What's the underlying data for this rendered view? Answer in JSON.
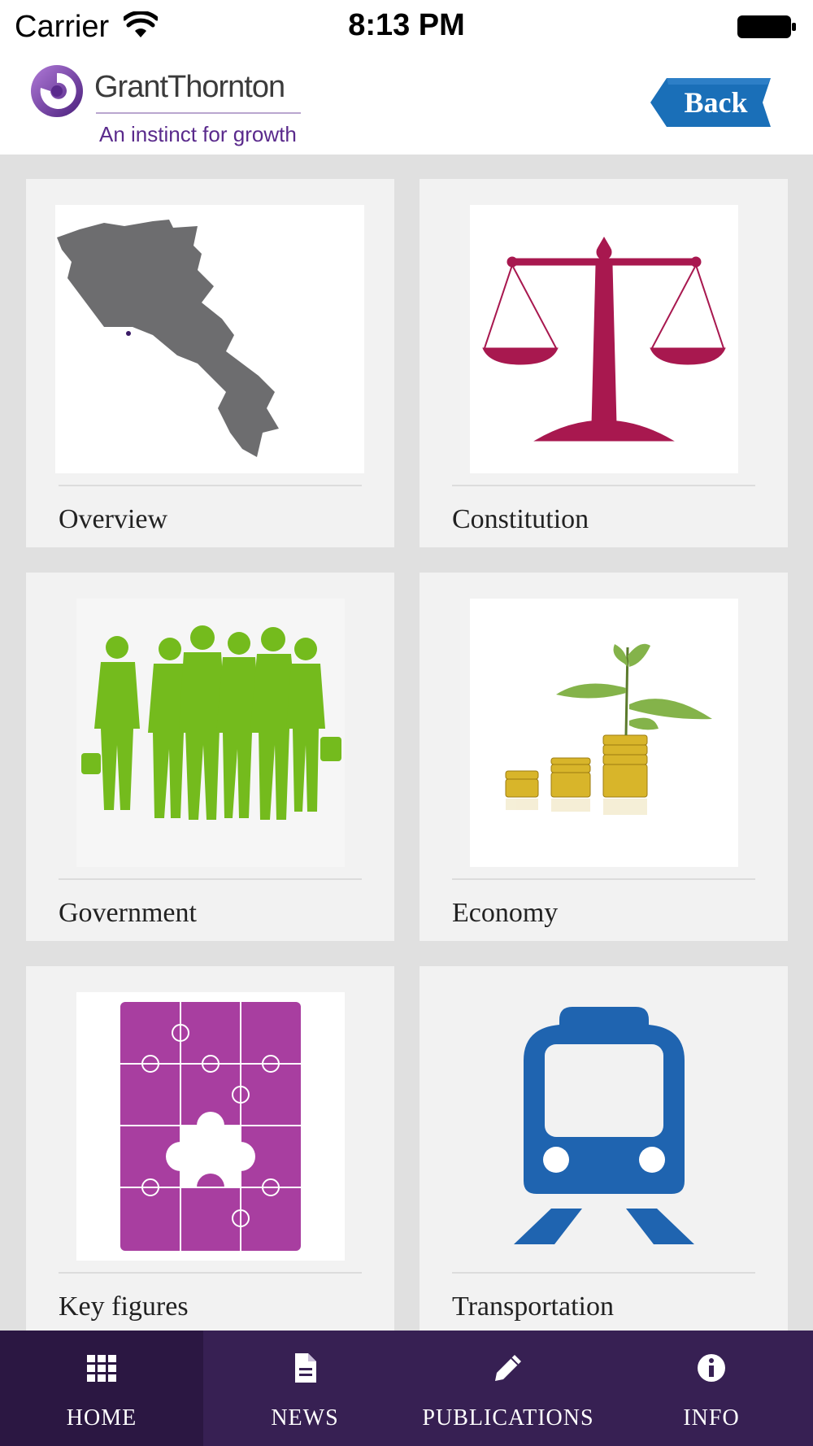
{
  "status_bar": {
    "carrier": "Carrier",
    "time": "8:13 PM"
  },
  "header": {
    "logo_name": "GrantThornton",
    "logo_tagline": "An instinct for growth",
    "back_label": "Back"
  },
  "colors": {
    "brand_purple": "#5a2a8c",
    "tab_bar": "#372053",
    "back_button": "#1a6fb8",
    "map_gray": "#6d6d6f",
    "scales_crimson": "#a8184f",
    "people_green": "#74bb1d",
    "puzzle_magenta": "#a83ea0",
    "train_blue": "#1f64b0"
  },
  "cards": [
    {
      "label": "Overview",
      "icon": "map-icon"
    },
    {
      "label": "Constitution",
      "icon": "scales-icon"
    },
    {
      "label": "Government",
      "icon": "people-icon"
    },
    {
      "label": "Economy",
      "icon": "coins-plant-icon"
    },
    {
      "label": "Key figures",
      "icon": "puzzle-icon"
    },
    {
      "label": "Transportation",
      "icon": "train-icon"
    }
  ],
  "tabs": [
    {
      "label": "HOME",
      "icon": "grid-icon",
      "active": true
    },
    {
      "label": "NEWS",
      "icon": "document-icon",
      "active": false
    },
    {
      "label": "PUBLICATIONS",
      "icon": "pencil-icon",
      "active": false
    },
    {
      "label": "INFO",
      "icon": "info-icon",
      "active": false
    }
  ]
}
